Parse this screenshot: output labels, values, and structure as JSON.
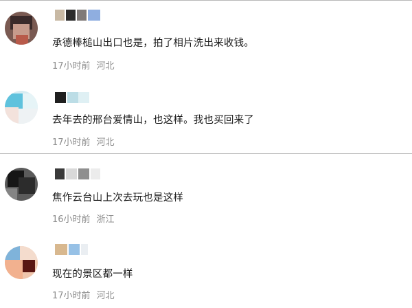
{
  "comments": [
    {
      "text": "承德棒槌山出口也是，拍了相片洗出来收钱。",
      "time": "17小时前",
      "location": "河北"
    },
    {
      "text": "去年去的邢台爱情山，也这样。我也买回来了",
      "time": "17小时前",
      "location": "河北"
    },
    {
      "text": "焦作云台山上次去玩也是这样",
      "time": "16小时前",
      "location": "浙江"
    },
    {
      "text": "现在的景区都一样",
      "time": "17小时前",
      "location": "河北"
    }
  ]
}
